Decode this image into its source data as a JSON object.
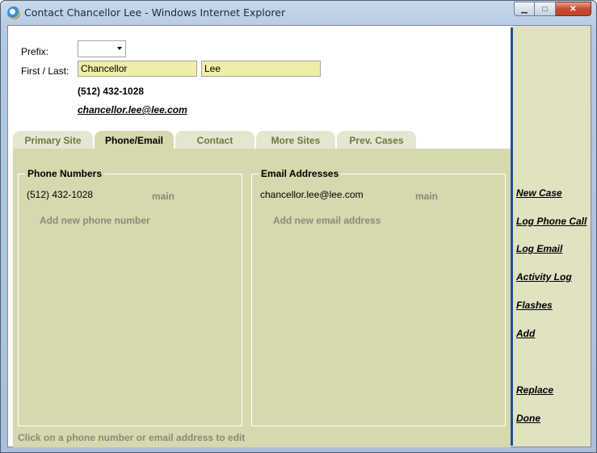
{
  "window": {
    "title": "Contact Chancellor Lee - Windows Internet Explorer",
    "buttons": {
      "minimize": "▁",
      "maximize": "□",
      "close": "✕"
    }
  },
  "form": {
    "prefix_label": "Prefix:",
    "prefix_value": "",
    "name_label": "First / Last:",
    "first_name": "Chancellor",
    "last_name": "Lee",
    "phone_display": "(512) 432-1028",
    "email_display": "chancellor.lee@lee.com"
  },
  "tabs": [
    {
      "label": "Primary Site",
      "active": false
    },
    {
      "label": "Phone/Email",
      "active": true
    },
    {
      "label": "Contact",
      "active": false
    },
    {
      "label": "More Sites",
      "active": false
    },
    {
      "label": "Prev. Cases",
      "active": false
    }
  ],
  "phone_section": {
    "title": "Phone Numbers",
    "entries": [
      {
        "value": "(512) 432-1028",
        "type": "main"
      }
    ],
    "add_label": "Add new phone number"
  },
  "email_section": {
    "title": "Email Addresses",
    "entries": [
      {
        "value": "chancellor.lee@lee.com",
        "type": "main"
      }
    ],
    "add_label": "Add new email address"
  },
  "hint": "Click on a phone number or email address to edit",
  "actions": [
    "New Case",
    "Log Phone Call",
    "Log Email",
    "Activity Log",
    "Flashes",
    "Add",
    "Replace",
    "Done"
  ],
  "colors": {
    "panel": "#d6d9ae",
    "tab_inactive": "#e5e6d2",
    "name_field": "#eeeea5",
    "divider": "#1f4fa0",
    "muted_text": "#8a8a7a"
  }
}
